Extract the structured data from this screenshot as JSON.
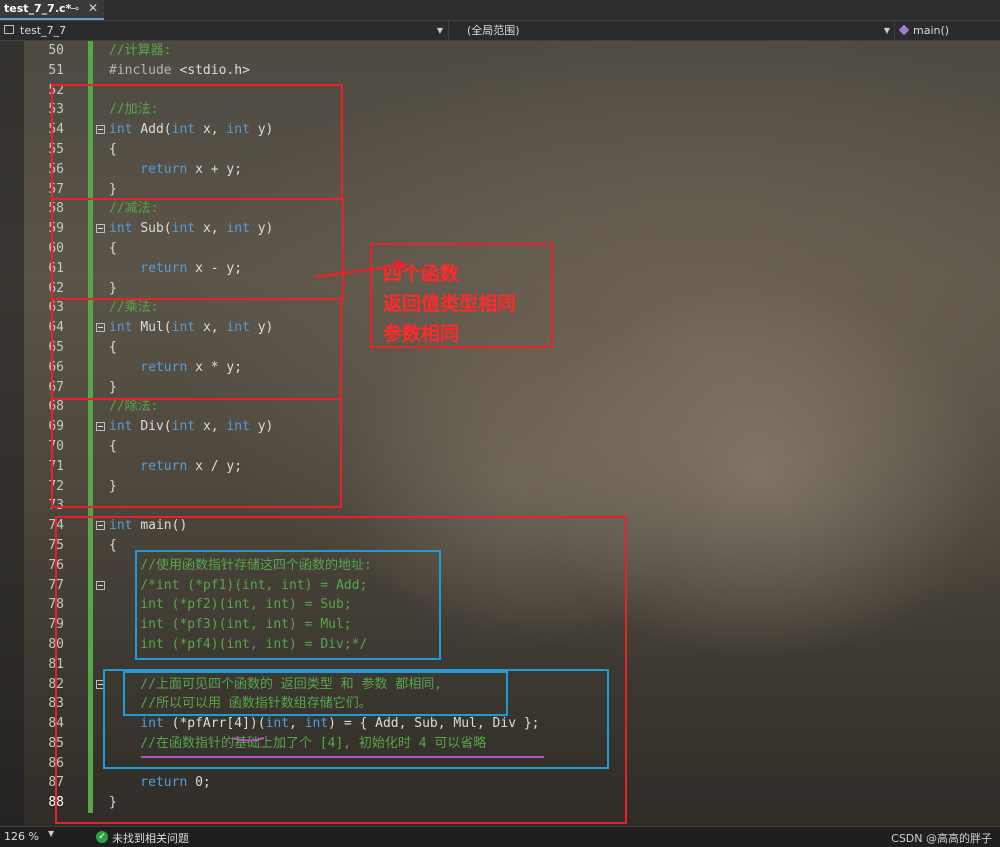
{
  "tab": {
    "title": "test_7_7.c*",
    "pin": "⊸",
    "close": "✕"
  },
  "nav": {
    "project": "test_7_7",
    "scope": "(全局范围)",
    "function": "main()"
  },
  "lines": [
    {
      "n": "50",
      "segs": [
        {
          "t": "//计算器:",
          "c": "c"
        }
      ]
    },
    {
      "n": "51",
      "segs": [
        {
          "t": "#include ",
          "c": "pp"
        },
        {
          "t": "<stdio.h>",
          "c": "p"
        }
      ]
    },
    {
      "n": "52",
      "segs": []
    },
    {
      "n": "53",
      "segs": [
        {
          "t": "//加法:",
          "c": "c"
        }
      ]
    },
    {
      "n": "54",
      "fold": true,
      "segs": [
        {
          "t": "int ",
          "c": "k"
        },
        {
          "t": "Add",
          "c": "p"
        },
        {
          "t": "(",
          "c": "p"
        },
        {
          "t": "int ",
          "c": "k"
        },
        {
          "t": "x, ",
          "c": "p"
        },
        {
          "t": "int ",
          "c": "k"
        },
        {
          "t": "y)",
          "c": "p"
        }
      ]
    },
    {
      "n": "55",
      "segs": [
        {
          "t": "{",
          "c": "p"
        }
      ]
    },
    {
      "n": "56",
      "segs": [
        {
          "t": "    return ",
          "c": "k"
        },
        {
          "t": "x + y;",
          "c": "p"
        }
      ]
    },
    {
      "n": "57",
      "segs": [
        {
          "t": "}",
          "c": "p"
        }
      ]
    },
    {
      "n": "58",
      "segs": [
        {
          "t": "//减法:",
          "c": "c"
        }
      ]
    },
    {
      "n": "59",
      "fold": true,
      "segs": [
        {
          "t": "int ",
          "c": "k"
        },
        {
          "t": "Sub",
          "c": "p"
        },
        {
          "t": "(",
          "c": "p"
        },
        {
          "t": "int ",
          "c": "k"
        },
        {
          "t": "x, ",
          "c": "p"
        },
        {
          "t": "int ",
          "c": "k"
        },
        {
          "t": "y)",
          "c": "p"
        }
      ]
    },
    {
      "n": "60",
      "segs": [
        {
          "t": "{",
          "c": "p"
        }
      ]
    },
    {
      "n": "61",
      "segs": [
        {
          "t": "    return ",
          "c": "k"
        },
        {
          "t": "x - y;",
          "c": "p"
        }
      ]
    },
    {
      "n": "62",
      "segs": [
        {
          "t": "}",
          "c": "p"
        }
      ]
    },
    {
      "n": "63",
      "segs": [
        {
          "t": "//乘法:",
          "c": "c"
        }
      ]
    },
    {
      "n": "64",
      "fold": true,
      "segs": [
        {
          "t": "int ",
          "c": "k"
        },
        {
          "t": "Mul",
          "c": "p"
        },
        {
          "t": "(",
          "c": "p"
        },
        {
          "t": "int ",
          "c": "k"
        },
        {
          "t": "x, ",
          "c": "p"
        },
        {
          "t": "int ",
          "c": "k"
        },
        {
          "t": "y)",
          "c": "p"
        }
      ]
    },
    {
      "n": "65",
      "segs": [
        {
          "t": "{",
          "c": "p"
        }
      ]
    },
    {
      "n": "66",
      "segs": [
        {
          "t": "    return ",
          "c": "k"
        },
        {
          "t": "x * y;",
          "c": "p"
        }
      ]
    },
    {
      "n": "67",
      "segs": [
        {
          "t": "}",
          "c": "p"
        }
      ]
    },
    {
      "n": "68",
      "segs": [
        {
          "t": "//除法:",
          "c": "c"
        }
      ]
    },
    {
      "n": "69",
      "fold": true,
      "segs": [
        {
          "t": "int ",
          "c": "k"
        },
        {
          "t": "Div",
          "c": "p"
        },
        {
          "t": "(",
          "c": "p"
        },
        {
          "t": "int ",
          "c": "k"
        },
        {
          "t": "x, ",
          "c": "p"
        },
        {
          "t": "int ",
          "c": "k"
        },
        {
          "t": "y)",
          "c": "p"
        }
      ]
    },
    {
      "n": "70",
      "segs": [
        {
          "t": "{",
          "c": "p"
        }
      ]
    },
    {
      "n": "71",
      "segs": [
        {
          "t": "    return ",
          "c": "k"
        },
        {
          "t": "x / y;",
          "c": "p"
        }
      ]
    },
    {
      "n": "72",
      "segs": [
        {
          "t": "}",
          "c": "p"
        }
      ]
    },
    {
      "n": "73",
      "segs": []
    },
    {
      "n": "74",
      "fold": true,
      "segs": [
        {
          "t": "int ",
          "c": "k"
        },
        {
          "t": "main",
          "c": "p"
        },
        {
          "t": "()",
          "c": "p"
        }
      ]
    },
    {
      "n": "75",
      "segs": [
        {
          "t": "{",
          "c": "p"
        }
      ]
    },
    {
      "n": "76",
      "segs": [
        {
          "t": "    //使用函数指针存储这四个函数的地址:",
          "c": "c"
        }
      ]
    },
    {
      "n": "77",
      "fold": true,
      "segs": [
        {
          "t": "    /*int (*pf1)(int, int) = Add;",
          "c": "c"
        }
      ]
    },
    {
      "n": "78",
      "segs": [
        {
          "t": "    int (*pf2)(int, int) = Sub;",
          "c": "c"
        }
      ]
    },
    {
      "n": "79",
      "segs": [
        {
          "t": "    int (*pf3)(int, int) = Mul;",
          "c": "c"
        }
      ]
    },
    {
      "n": "80",
      "segs": [
        {
          "t": "    int (*pf4)(int, int) = Div;*/",
          "c": "c"
        }
      ]
    },
    {
      "n": "81",
      "segs": []
    },
    {
      "n": "82",
      "fold": true,
      "segs": [
        {
          "t": "    //上面可见四个函数的 返回类型 和 参数 都相同,",
          "c": "c"
        }
      ]
    },
    {
      "n": "83",
      "segs": [
        {
          "t": "    //所以可以用 函数指针数组存储它们。",
          "c": "c"
        }
      ]
    },
    {
      "n": "84",
      "segs": [
        {
          "t": "    int ",
          "c": "k"
        },
        {
          "t": "(*pfArr[4])(",
          "c": "p"
        },
        {
          "t": "int",
          "c": "k"
        },
        {
          "t": ", ",
          "c": "p"
        },
        {
          "t": "int",
          "c": "k"
        },
        {
          "t": ") = { ",
          "c": "p"
        },
        {
          "t": "Add, Sub, Mul, Div",
          "c": "p"
        },
        {
          "t": " };",
          "c": "p"
        }
      ]
    },
    {
      "n": "85",
      "segs": [
        {
          "t": "    //在函数指针的基础上加了个 [4], 初始化时 4 可以省略",
          "c": "c"
        }
      ]
    },
    {
      "n": "86",
      "segs": []
    },
    {
      "n": "87",
      "segs": [
        {
          "t": "    return ",
          "c": "k"
        },
        {
          "t": "0;",
          "c": "p"
        }
      ]
    },
    {
      "n": "88",
      "cur": true,
      "segs": [
        {
          "t": "}",
          "c": "p"
        }
      ]
    }
  ],
  "annotation": {
    "lines": [
      "四个函数",
      "返回值类型相同",
      "参数相同"
    ]
  },
  "status": {
    "zoom": "126 %",
    "issues": "未找到相关问题",
    "watermark": "CSDN @高高的胖子"
  }
}
